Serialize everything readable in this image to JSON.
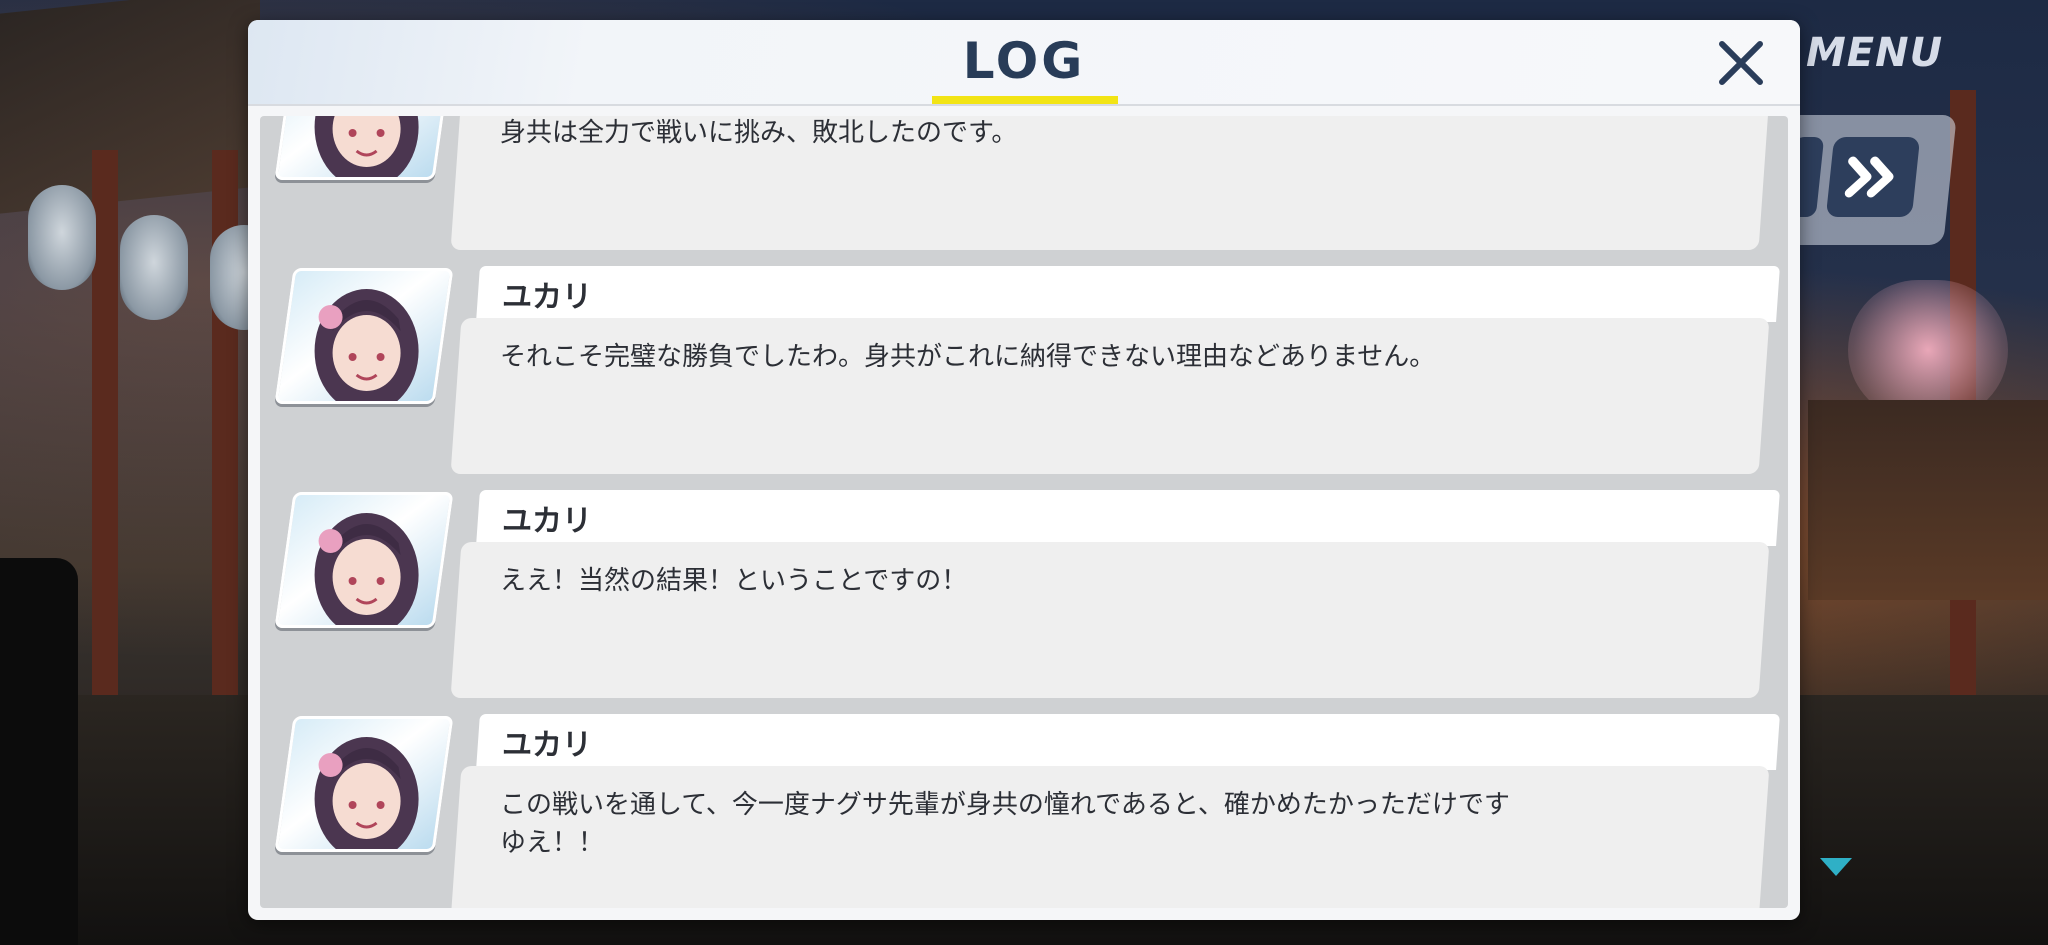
{
  "background": {
    "menu_label": "MENU",
    "fast_forward_icon": "double-chevron-right-icon"
  },
  "log": {
    "title": "LOG",
    "close_icon": "close-icon",
    "entries": [
      {
        "speaker": "",
        "text": "身共は全力で戦いに挑み、敗北したのです。"
      },
      {
        "speaker": "ユカリ",
        "text": "それこそ完璧な勝負でしたわ。身共がこれに納得できない理由などありません。"
      },
      {
        "speaker": "ユカリ",
        "text": "ええ！当然の結果！ということですの！"
      },
      {
        "speaker": "ユカリ",
        "text": "この戦いを通して、今一度ナグサ先輩が身共の憧れであると、確かめたかっただけですゆえ！！"
      }
    ]
  },
  "colors": {
    "title": "#283c58",
    "underline": "#f2e415",
    "accent_button": "#2d3e5c"
  }
}
